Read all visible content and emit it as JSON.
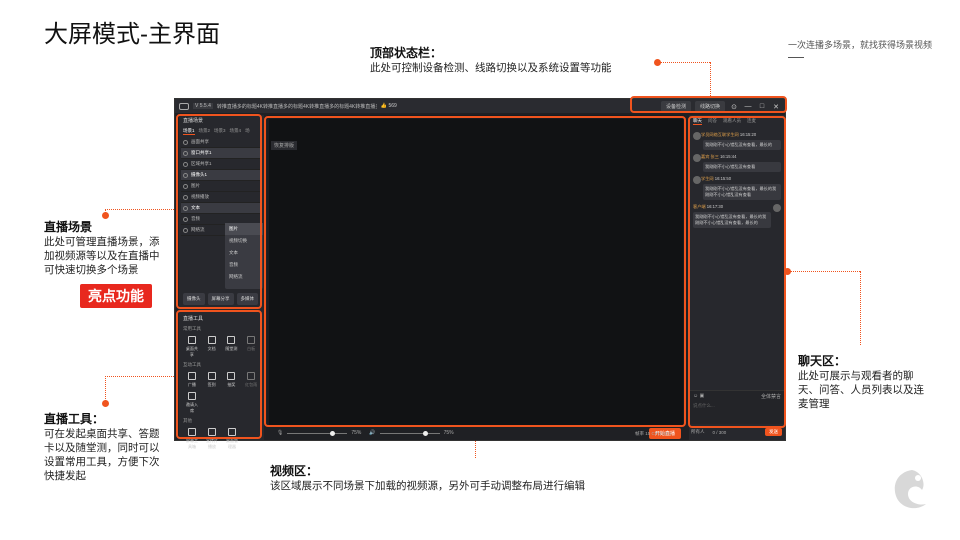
{
  "slide": {
    "title": "大屏模式-主界面",
    "note": "一次连播多场景，就找获得场景视频",
    "highlight_badge": "亮点功能"
  },
  "annotations": {
    "top_status": {
      "title": "顶部状态栏：",
      "text": "此处可控制设备检测、线路切换以及系统设置等功能"
    },
    "scenes": {
      "title": "直播场景",
      "text": "此处可管理直播场景，添加视频源等以及在直播中可快速切换多个场景"
    },
    "tools": {
      "title": "直播工具：",
      "text": "可在发起桌面共享、答题卡以及随堂测，同时可以设置常用工具，方便下次快捷发起"
    },
    "video": {
      "title": "视频区：",
      "text": "该区域展示不同场景下加载的视频源，另外可手动调整布局进行编辑"
    },
    "chat": {
      "title": "聊天区：",
      "text": "此处可展示与观看者的聊天、问答、人员列表以及连麦管理"
    }
  },
  "app": {
    "version": "V 5.5.4",
    "title": "转推直播多的标题4K转推直播多的标题4K转推直播多的标题4K转推直播多的标题4K转",
    "likes": "👍 569",
    "device_check": "设备检测",
    "line_switch": "线路切换",
    "win_controls": [
      "⊙",
      "—",
      "□",
      "✕"
    ],
    "scene_panel_title": "直播场景",
    "scene_tabs": [
      "场景1",
      "场景2",
      "场景3",
      "场景4",
      "场"
    ],
    "scene_rows": [
      "画面共享",
      "窗口共享1",
      "区域共享1",
      "摄像头1",
      "图片",
      "视频播放",
      "文本",
      "音频",
      "网络流"
    ],
    "context_menu": [
      "图片",
      "视频切换",
      "文本",
      "音频",
      "网络流"
    ],
    "scene_buttons": [
      "摄像头",
      "屏幕分享",
      "多媒体"
    ],
    "tools_title": "直播工具",
    "tools_common": "常用工具",
    "tools_row1": [
      "桌面共享",
      "文档",
      "随堂测",
      "白板"
    ],
    "tools_interact": "互动工具",
    "tools_row2": [
      "广播",
      "签到",
      "抽奖",
      "红包雨"
    ],
    "tools_row3": [
      "邀请入席"
    ],
    "tools_other": "其他",
    "tools_row4": [
      "屏幕工具箱",
      "宣传片播放",
      "桌面管理器"
    ],
    "video_label": "恢复排版",
    "mic_pct": "75%",
    "spk_pct": "75%",
    "mic_level": 0.75,
    "spk_level": 0.75,
    "start_live": "开始直播",
    "chat_tabs": [
      "聊天",
      "问答",
      "观看人员",
      "连麦"
    ],
    "chat_msgs": [
      {
        "name": "学员网络互联学生网",
        "time": "16:15:20",
        "text": "我刚刚不小心错乱没有查看，最长的"
      },
      {
        "name": "嘉宾 张三",
        "time": "16:15:44",
        "text": "我刚刚不小心错乱没有查看"
      },
      {
        "name": "学生网",
        "time": "16:15:50",
        "text": "我刚刚不小心错乱没有查看，最长的我刚刚不小心错乱没有查看"
      },
      {
        "name": "客户端",
        "time": "16:17:30",
        "text": "我刚刚不小心错乱没有查看，最长的我刚刚不小心错乱没有查看，最长的"
      }
    ],
    "chat_placeholder": "说点什么...",
    "chat_toggle": "全体禁言",
    "send_to": "所有人",
    "char_count": "0 / 300",
    "send": "发送",
    "status": "帧率  15  CPU  60%"
  }
}
